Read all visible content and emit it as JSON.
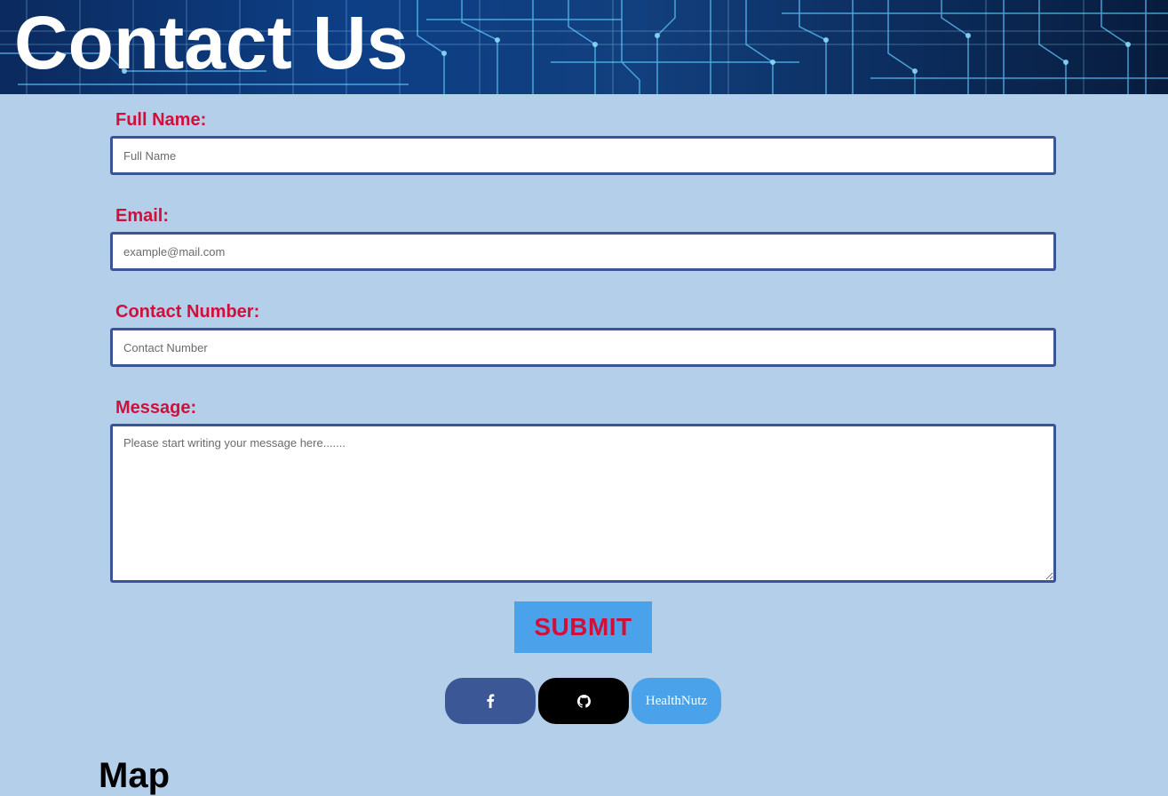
{
  "header": {
    "title": "Contact Us"
  },
  "form": {
    "full_name": {
      "label": "Full Name:",
      "placeholder": "Full Name",
      "value": ""
    },
    "email": {
      "label": "Email:",
      "placeholder": "example@mail.com",
      "value": ""
    },
    "contact_number": {
      "label": "Contact Number:",
      "placeholder": "Contact Number",
      "value": ""
    },
    "message": {
      "label": "Message:",
      "placeholder": "Please start writing your message here.......",
      "value": ""
    },
    "submit_label": "SUBMIT"
  },
  "social": {
    "facebook_icon": "facebook-icon",
    "github_icon": "github-icon",
    "healthnutz_label": "HealthNutz"
  },
  "map": {
    "heading": "Map"
  },
  "colors": {
    "page_background": "#b3cfe9",
    "label_color": "#d0103a",
    "input_border": "#3a5596",
    "submit_background": "#4aa3ea",
    "facebook_background": "#3b5796",
    "github_background": "#000000",
    "healthnutz_background": "#4aa3ea"
  }
}
